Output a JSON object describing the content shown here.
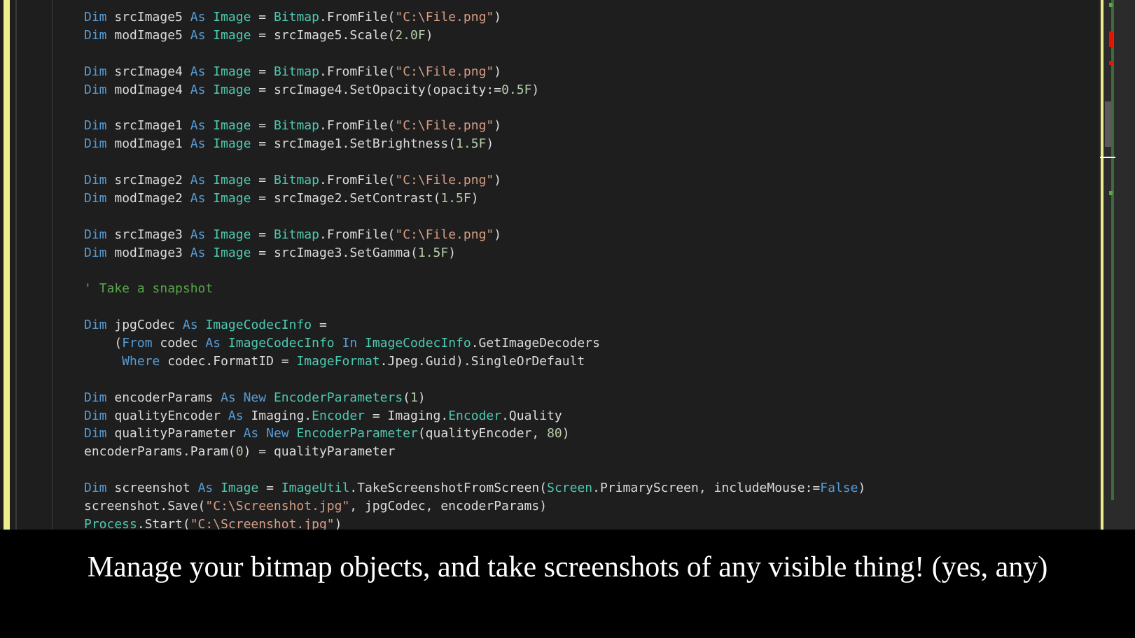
{
  "editor": {
    "lines": [
      [
        [
          "kw",
          "Dim "
        ],
        [
          "t",
          "srcImage5 "
        ],
        [
          "kw",
          "As "
        ],
        [
          "ty",
          "Image"
        ],
        [
          "t",
          " = "
        ],
        [
          "ty",
          "Bitmap"
        ],
        [
          "t",
          ".FromFile("
        ],
        [
          "str",
          "\"C:\\File.png\""
        ],
        [
          "t",
          ")"
        ]
      ],
      [
        [
          "kw",
          "Dim "
        ],
        [
          "t",
          "modImage5 "
        ],
        [
          "kw",
          "As "
        ],
        [
          "ty",
          "Image"
        ],
        [
          "t",
          " = srcImage5.Scale("
        ],
        [
          "num",
          "2.0F"
        ],
        [
          "t",
          ")"
        ]
      ],
      [],
      [
        [
          "kw",
          "Dim "
        ],
        [
          "t",
          "srcImage4 "
        ],
        [
          "kw",
          "As "
        ],
        [
          "ty",
          "Image"
        ],
        [
          "t",
          " = "
        ],
        [
          "ty",
          "Bitmap"
        ],
        [
          "t",
          ".FromFile("
        ],
        [
          "str",
          "\"C:\\File.png\""
        ],
        [
          "t",
          ")"
        ]
      ],
      [
        [
          "kw",
          "Dim "
        ],
        [
          "t",
          "modImage4 "
        ],
        [
          "kw",
          "As "
        ],
        [
          "ty",
          "Image"
        ],
        [
          "t",
          " = srcImage4.SetOpacity(opacity:="
        ],
        [
          "num",
          "0.5F"
        ],
        [
          "t",
          ")"
        ]
      ],
      [],
      [
        [
          "kw",
          "Dim "
        ],
        [
          "t",
          "srcImage1 "
        ],
        [
          "kw",
          "As "
        ],
        [
          "ty",
          "Image"
        ],
        [
          "t",
          " = "
        ],
        [
          "ty",
          "Bitmap"
        ],
        [
          "t",
          ".FromFile("
        ],
        [
          "str",
          "\"C:\\File.png\""
        ],
        [
          "t",
          ")"
        ]
      ],
      [
        [
          "kw",
          "Dim "
        ],
        [
          "t",
          "modImage1 "
        ],
        [
          "kw",
          "As "
        ],
        [
          "ty",
          "Image"
        ],
        [
          "t",
          " = srcImage1.SetBrightness("
        ],
        [
          "num",
          "1.5F"
        ],
        [
          "t",
          ")"
        ]
      ],
      [],
      [
        [
          "kw",
          "Dim "
        ],
        [
          "t",
          "srcImage2 "
        ],
        [
          "kw",
          "As "
        ],
        [
          "ty",
          "Image"
        ],
        [
          "t",
          " = "
        ],
        [
          "ty",
          "Bitmap"
        ],
        [
          "t",
          ".FromFile("
        ],
        [
          "str",
          "\"C:\\File.png\""
        ],
        [
          "t",
          ")"
        ]
      ],
      [
        [
          "kw",
          "Dim "
        ],
        [
          "t",
          "modImage2 "
        ],
        [
          "kw",
          "As "
        ],
        [
          "ty",
          "Image"
        ],
        [
          "t",
          " = srcImage2.SetContrast("
        ],
        [
          "num",
          "1.5F"
        ],
        [
          "t",
          ")"
        ]
      ],
      [],
      [
        [
          "kw",
          "Dim "
        ],
        [
          "t",
          "srcImage3 "
        ],
        [
          "kw",
          "As "
        ],
        [
          "ty",
          "Image"
        ],
        [
          "t",
          " = "
        ],
        [
          "ty",
          "Bitmap"
        ],
        [
          "t",
          ".FromFile("
        ],
        [
          "str",
          "\"C:\\File.png\""
        ],
        [
          "t",
          ")"
        ]
      ],
      [
        [
          "kw",
          "Dim "
        ],
        [
          "t",
          "modImage3 "
        ],
        [
          "kw",
          "As "
        ],
        [
          "ty",
          "Image"
        ],
        [
          "t",
          " = srcImage3.SetGamma("
        ],
        [
          "num",
          "1.5F"
        ],
        [
          "t",
          ")"
        ]
      ],
      [],
      [
        [
          "cm",
          "' Take a snapshot"
        ]
      ],
      [],
      [
        [
          "kw",
          "Dim "
        ],
        [
          "t",
          "jpgCodec "
        ],
        [
          "kw",
          "As "
        ],
        [
          "ty",
          "ImageCodecInfo"
        ],
        [
          "t",
          " ="
        ]
      ],
      [
        [
          "t",
          "    ("
        ],
        [
          "kw",
          "From "
        ],
        [
          "t",
          "codec "
        ],
        [
          "kw",
          "As "
        ],
        [
          "ty",
          "ImageCodecInfo"
        ],
        [
          "kw",
          " In "
        ],
        [
          "ty",
          "ImageCodecInfo"
        ],
        [
          "t",
          ".GetImageDecoders"
        ]
      ],
      [
        [
          "kw",
          "     Where "
        ],
        [
          "t",
          "codec.FormatID = "
        ],
        [
          "ty",
          "ImageFormat"
        ],
        [
          "t",
          ".Jpeg.Guid).SingleOrDefault"
        ]
      ],
      [],
      [
        [
          "kw",
          "Dim "
        ],
        [
          "t",
          "encoderParams "
        ],
        [
          "kw",
          "As New "
        ],
        [
          "ty",
          "EncoderParameters"
        ],
        [
          "t",
          "("
        ],
        [
          "num",
          "1"
        ],
        [
          "t",
          ")"
        ]
      ],
      [
        [
          "kw",
          "Dim "
        ],
        [
          "t",
          "qualityEncoder "
        ],
        [
          "kw",
          "As "
        ],
        [
          "t",
          "Imaging."
        ],
        [
          "ty",
          "Encoder"
        ],
        [
          "t",
          " = Imaging."
        ],
        [
          "ty",
          "Encoder"
        ],
        [
          "t",
          ".Quality"
        ]
      ],
      [
        [
          "kw",
          "Dim "
        ],
        [
          "t",
          "qualityParameter "
        ],
        [
          "kw",
          "As New "
        ],
        [
          "ty",
          "EncoderParameter"
        ],
        [
          "t",
          "(qualityEncoder, "
        ],
        [
          "num",
          "80"
        ],
        [
          "t",
          ")"
        ]
      ],
      [
        [
          "t",
          "encoderParams.Param("
        ],
        [
          "num",
          "0"
        ],
        [
          "t",
          ") = qualityParameter"
        ]
      ],
      [],
      [
        [
          "kw",
          "Dim "
        ],
        [
          "t",
          "screenshot "
        ],
        [
          "kw",
          "As "
        ],
        [
          "ty",
          "Image"
        ],
        [
          "t",
          " = "
        ],
        [
          "ty",
          "ImageUtil"
        ],
        [
          "t",
          ".TakeScreenshotFromScreen("
        ],
        [
          "ty",
          "Screen"
        ],
        [
          "t",
          ".PrimaryScreen, includeMouse:="
        ],
        [
          "kw",
          "False"
        ],
        [
          "t",
          ")"
        ]
      ],
      [
        [
          "t",
          "screenshot.Save("
        ],
        [
          "str",
          "\"C:\\Screenshot.jpg\""
        ],
        [
          "t",
          ", jpgCodec, encoderParams)"
        ]
      ],
      [
        [
          "ty",
          "Process"
        ],
        [
          "t",
          ".Start("
        ],
        [
          "str",
          "\"C:\\Screenshot.jpg\""
        ],
        [
          "t",
          ")"
        ]
      ]
    ]
  },
  "colors": {
    "keyword": "#569cd6",
    "type": "#4ec9b0",
    "string": "#d69d85",
    "number": "#b5cea8",
    "comment": "#57a64a",
    "text": "#dcdcdc"
  },
  "caption": {
    "text": "Manage your bitmap objects, and take screenshots of any visible thing! (yes, any)"
  }
}
